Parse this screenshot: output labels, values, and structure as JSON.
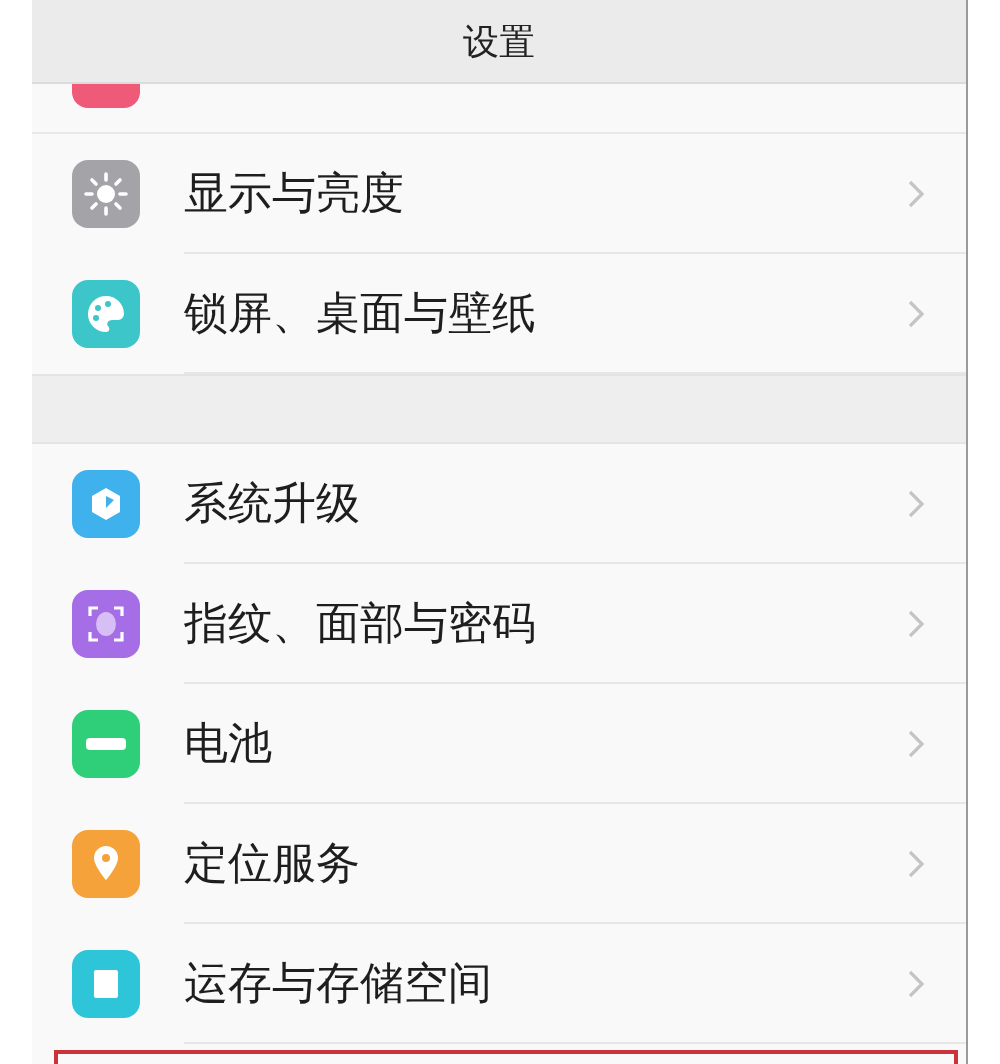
{
  "header": {
    "title": "设置"
  },
  "groups": [
    {
      "items": [
        {
          "kind": "partial",
          "selected": false
        },
        {
          "kind": "item",
          "label": "显示与亮度",
          "selected": false
        },
        {
          "kind": "item",
          "label": "锁屏、桌面与壁纸",
          "selected": false
        }
      ]
    },
    {
      "items": [
        {
          "kind": "item",
          "label": "系统升级",
          "selected": false
        },
        {
          "kind": "item",
          "label": "指纹、面部与密码",
          "selected": false
        },
        {
          "kind": "item",
          "label": "电池",
          "selected": false
        },
        {
          "kind": "item",
          "label": "定位服务",
          "selected": false
        },
        {
          "kind": "item",
          "label": "运存与存储空间",
          "selected": false
        },
        {
          "kind": "cut",
          "selected": true
        }
      ]
    }
  ]
}
